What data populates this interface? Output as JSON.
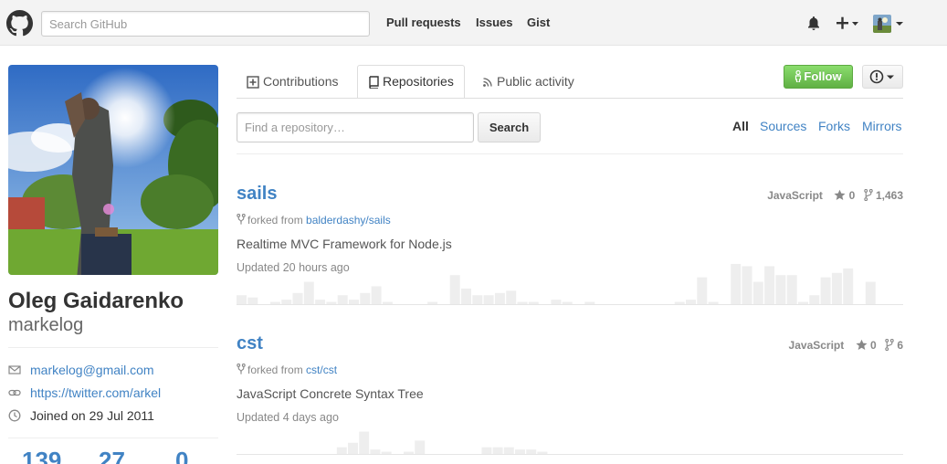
{
  "header": {
    "search_placeholder": "Search GitHub",
    "nav": [
      "Pull requests",
      "Issues",
      "Gist"
    ]
  },
  "profile": {
    "fullname": "Oleg Gaidarenko",
    "username": "markelog",
    "email": "markelog@gmail.com",
    "website": "https://twitter.com/arkel",
    "joined": "Joined on 29 Jul 2011",
    "stats": [
      "139",
      "27",
      "0"
    ]
  },
  "tabs": {
    "contributions": "Contributions",
    "repositories": "Repositories",
    "activity": "Public activity"
  },
  "actions": {
    "follow": "Follow"
  },
  "repo_search": {
    "placeholder": "Find a repository…",
    "button": "Search"
  },
  "filters": [
    "All",
    "Sources",
    "Forks",
    "Mirrors"
  ],
  "repos": [
    {
      "name": "sails",
      "language": "JavaScript",
      "stars": "0",
      "forks": "1,463",
      "forked_prefix": "forked from",
      "forked_from": "balderdashy/sails",
      "description": "Realtime MVC Framework for Node.js",
      "updated": "Updated 20 hours ago"
    },
    {
      "name": "cst",
      "language": "JavaScript",
      "stars": "0",
      "forks": "6",
      "forked_prefix": "forked from",
      "forked_from": "cst/cst",
      "description": "JavaScript Concrete Syntax Tree",
      "updated": "Updated 4 days ago"
    }
  ],
  "colors": {
    "link": "#4183c4",
    "follow_green": "#60b044"
  }
}
